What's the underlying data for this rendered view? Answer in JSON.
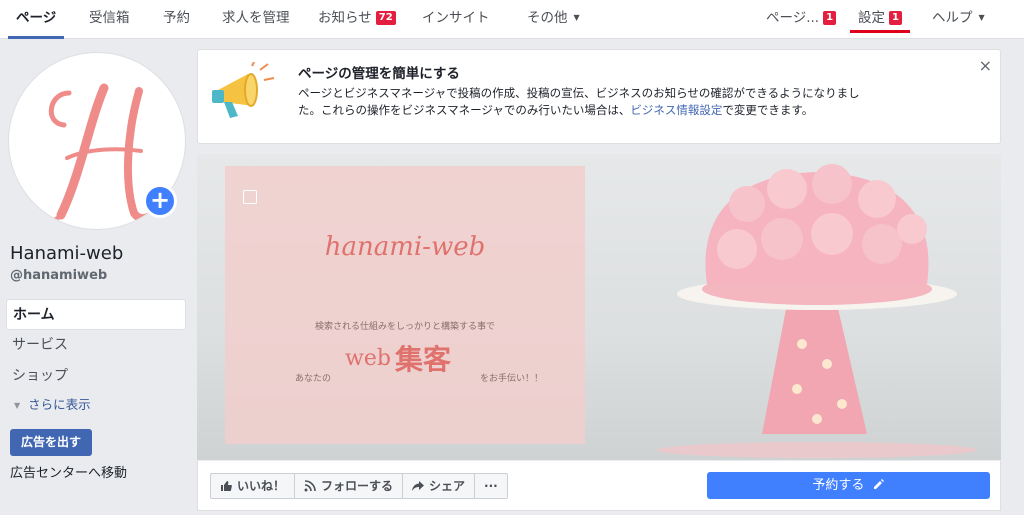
{
  "nav": {
    "tabs": [
      {
        "label": "ページ"
      },
      {
        "label": "受信箱"
      },
      {
        "label": "予約"
      },
      {
        "label": "求人を管理"
      },
      {
        "label": "お知らせ",
        "badge": "72"
      },
      {
        "label": "インサイト"
      },
      {
        "label": "その他"
      }
    ],
    "right": [
      {
        "label": "ページ...",
        "badge": "1"
      },
      {
        "label": "設定",
        "badge": "1"
      },
      {
        "label": "ヘルプ"
      }
    ]
  },
  "profile": {
    "monogram": "H",
    "name": "Hanami-web",
    "handle": "@hanamiweb",
    "plus": "+"
  },
  "sidebar": {
    "items": [
      {
        "label": "ホーム"
      },
      {
        "label": "サービス"
      },
      {
        "label": "ショップ"
      }
    ],
    "more": "さらに表示",
    "ads_button": "広告を出す",
    "ads_center": "広告センターへ移動"
  },
  "notice": {
    "title": "ページの管理を簡単にする",
    "body_pre": "ページとビジネスマネージャで投稿の作成、投稿の宣伝、ビジネスのお知らせの確認ができるようになりました。これらの操作をビジネスマネージャでのみ行いたい場合は、",
    "link": "ビジネス情報設定",
    "body_post": "で変更できます。",
    "close": "×"
  },
  "cover": {
    "brand": "hanami-web",
    "line1": "検索される仕組みをしっかりと構築する事で",
    "line2": "あなたの",
    "big1": "web",
    "big2": "集客",
    "line3": "をお手伝い！！"
  },
  "actions": {
    "like": "いいね！",
    "follow": "フォローする",
    "share": "シェア",
    "more": "···",
    "book": "予約する"
  },
  "colors": {
    "accent": "#4267b2",
    "primary_button": "#4080ff",
    "badge": "#e41e3f",
    "brand_pink": "#e0726e"
  }
}
